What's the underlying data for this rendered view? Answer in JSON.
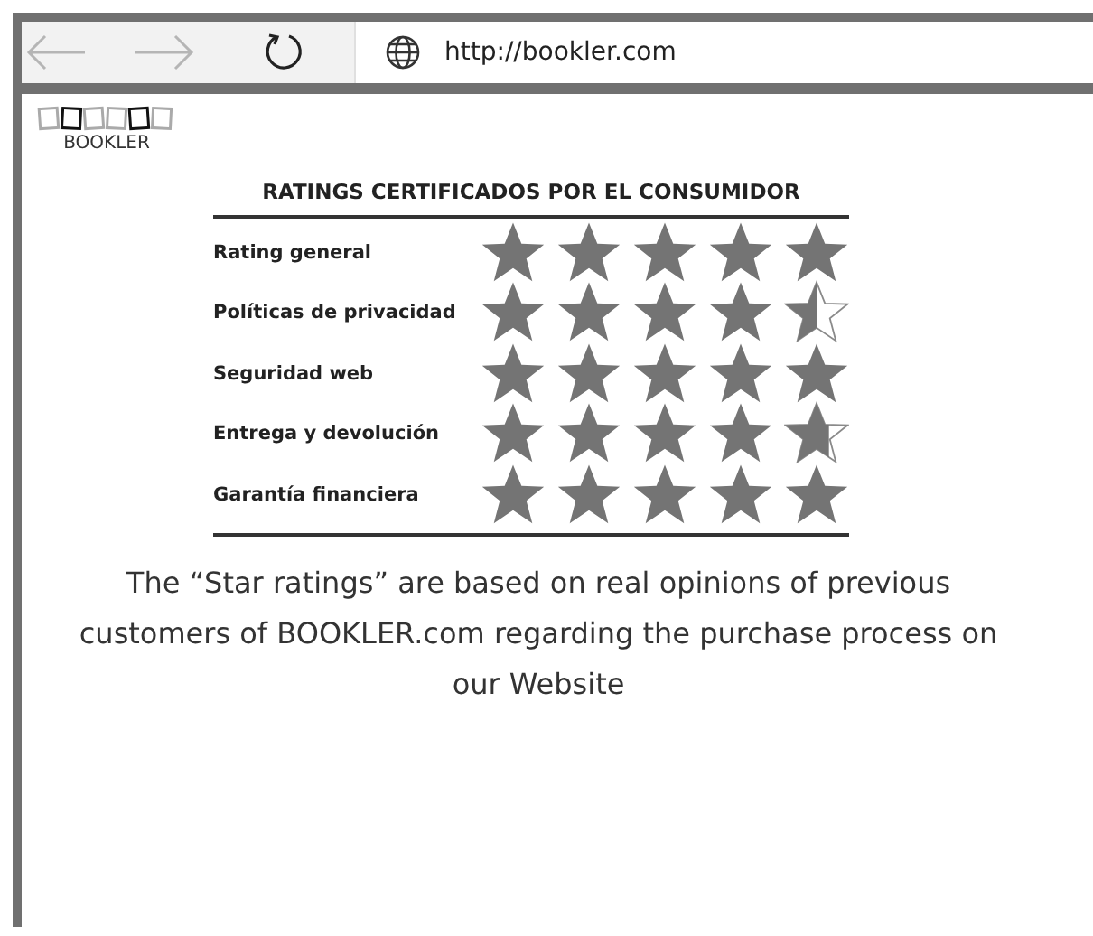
{
  "browser": {
    "url": "http://bookler.com"
  },
  "logo": {
    "text": "BOOKLER"
  },
  "ratings": {
    "title": "RATINGS CERTIFICADOS POR EL CONSUMIDOR",
    "rows": [
      {
        "label": "Rating general",
        "stars": 5
      },
      {
        "label": "Políticas de privacidad",
        "stars": 4.5
      },
      {
        "label": "Seguridad web",
        "stars": 5
      },
      {
        "label": "Entrega y devolución",
        "stars": 4.7
      },
      {
        "label": "Garantía financiera",
        "stars": 5
      }
    ]
  },
  "caption": "The “Star ratings” are based on real opinions of previous customers of BOOKLER.com regarding the purchase process on our Website"
}
